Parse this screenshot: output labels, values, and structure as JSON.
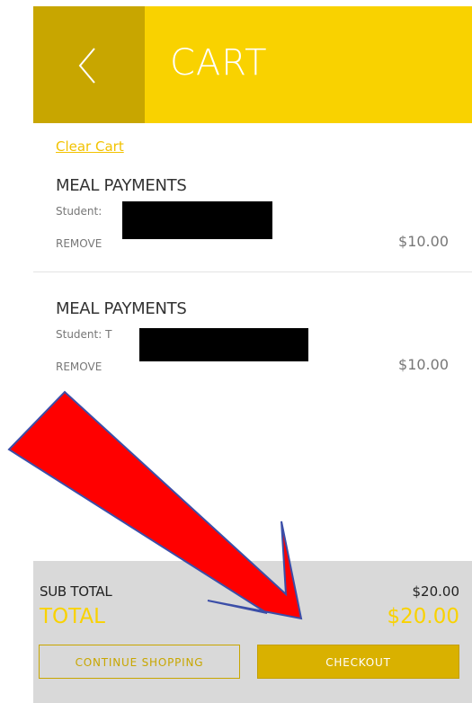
{
  "header": {
    "title": "CART",
    "back_icon": "chevron-left-icon",
    "background_color": "#f9d200",
    "back_color": "#c8a600"
  },
  "cart": {
    "clear_label": "Clear Cart",
    "items": [
      {
        "title": "MEAL PAYMENTS",
        "student_label": "Student:",
        "remove_label": "REMOVE",
        "price": "$10.00"
      },
      {
        "title": "MEAL PAYMENTS",
        "student_label": "Student: T",
        "remove_label": "REMOVE",
        "price": "$10.00"
      }
    ]
  },
  "summary": {
    "subtotal_label": "SUB TOTAL",
    "subtotal_value": "$20.00",
    "total_label": "TOTAL",
    "total_value": "$20.00",
    "accent_color": "#f9d200"
  },
  "actions": {
    "continue_label": "CONTINUE SHOPPING",
    "checkout_label": "CHECKOUT"
  },
  "annotation": {
    "arrow_color": "#ff0000"
  }
}
